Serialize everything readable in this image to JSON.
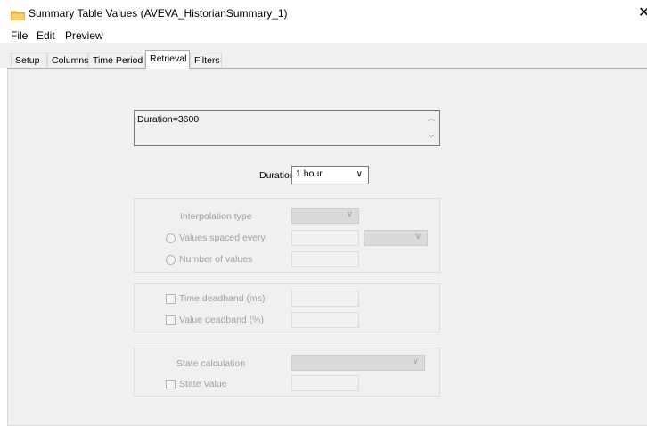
{
  "window": {
    "title": "Summary Table Values (AVEVA_HistorianSummary_1)",
    "close_glyph": "✕",
    "icon": "folder-icon"
  },
  "menu": [
    {
      "label": "File"
    },
    {
      "label": "Edit"
    },
    {
      "label": "Preview"
    }
  ],
  "tabs": [
    {
      "label": "Setup"
    },
    {
      "label": "Columns"
    },
    {
      "label": "Time Period"
    },
    {
      "label": "Retrieval",
      "active": true
    },
    {
      "label": "Filters"
    }
  ],
  "retrieval": {
    "query_text": "Duration=3600",
    "duration": {
      "label": "Duration",
      "value": "1 hour"
    },
    "interpolation": {
      "label": "Interpolation type",
      "value": "",
      "values_spaced_every_label": "Values spaced every",
      "values_spaced_every_value": "",
      "values_spaced_unit": "",
      "number_of_values_label": "Number of values",
      "number_of_values_value": ""
    },
    "deadband": {
      "time_label": "Time deadband (ms)",
      "time_value": "",
      "value_label": "Value deadband (%)",
      "value_value": ""
    },
    "state": {
      "label": "State calculation",
      "value": "",
      "state_value_label": "State Value",
      "state_value_value": ""
    }
  },
  "colors": {
    "panel": "#f0f0f0",
    "disabled_text": "#a0a0a0"
  }
}
